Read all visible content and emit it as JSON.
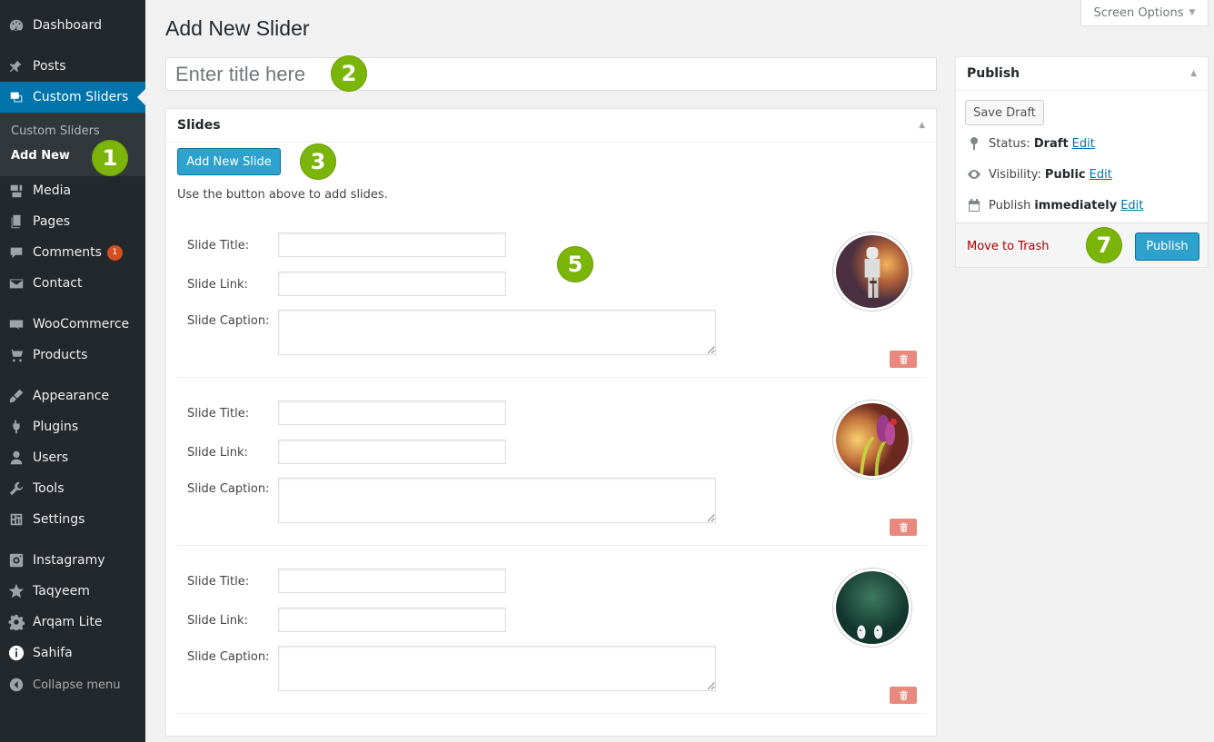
{
  "sidebar": {
    "items": [
      {
        "label": "Dashboard",
        "icon": "dashboard-icon"
      },
      {
        "label": "Posts",
        "icon": "pin-icon"
      },
      {
        "label": "Custom Sliders",
        "icon": "sliders-icon"
      },
      {
        "label": "Media",
        "icon": "media-icon"
      },
      {
        "label": "Pages",
        "icon": "pages-icon"
      },
      {
        "label": "Comments",
        "icon": "comment-icon",
        "badge": "1"
      },
      {
        "label": "Contact",
        "icon": "mail-icon"
      },
      {
        "label": "WooCommerce",
        "icon": "woocommerce-icon"
      },
      {
        "label": "Products",
        "icon": "cart-icon"
      },
      {
        "label": "Appearance",
        "icon": "brush-icon"
      },
      {
        "label": "Plugins",
        "icon": "plugin-icon"
      },
      {
        "label": "Users",
        "icon": "user-icon"
      },
      {
        "label": "Tools",
        "icon": "wrench-icon"
      },
      {
        "label": "Settings",
        "icon": "settings-icon"
      },
      {
        "label": "Instagramy",
        "icon": "instagram-icon"
      },
      {
        "label": "Taqyeem",
        "icon": "star-icon"
      },
      {
        "label": "Arqam Lite",
        "icon": "gear-icon"
      },
      {
        "label": "Sahifa",
        "icon": "info-icon"
      }
    ],
    "submenu": [
      "Custom Sliders",
      "Add New"
    ],
    "collapse_label": "Collapse menu"
  },
  "header": {
    "title": "Add New Slider",
    "screen_options": "Screen Options"
  },
  "title_placeholder": "Enter title here",
  "slides": {
    "heading": "Slides",
    "add_button": "Add New Slide",
    "help_text": "Use the button above to add slides.",
    "labels": {
      "title": "Slide Title:",
      "link": "Slide Link:",
      "caption": "Slide Caption:"
    },
    "items": [
      {
        "title": "",
        "link": "",
        "caption": "",
        "thumb": "stormtrooper-photo"
      },
      {
        "title": "",
        "link": "",
        "caption": "",
        "thumb": "flower-photo"
      },
      {
        "title": "",
        "link": "",
        "caption": "",
        "thumb": "green-photo"
      }
    ]
  },
  "publish": {
    "heading": "Publish",
    "save_draft": "Save Draft",
    "status_label": "Status:",
    "status_value": "Draft",
    "visibility_label": "Visibility:",
    "visibility_value": "Public",
    "schedule_label": "Publish",
    "schedule_value": "immediately",
    "edit": "Edit",
    "trash": "Move to Trash",
    "publish_button": "Publish"
  },
  "steps": [
    "1",
    "2",
    "3",
    "5",
    "7"
  ],
  "colors": {
    "sidebar_bg": "#23282d",
    "accent": "#0073aa",
    "button": "#2ea2cc",
    "step_marker": "#7cb50a",
    "delete": "#e8897d"
  }
}
